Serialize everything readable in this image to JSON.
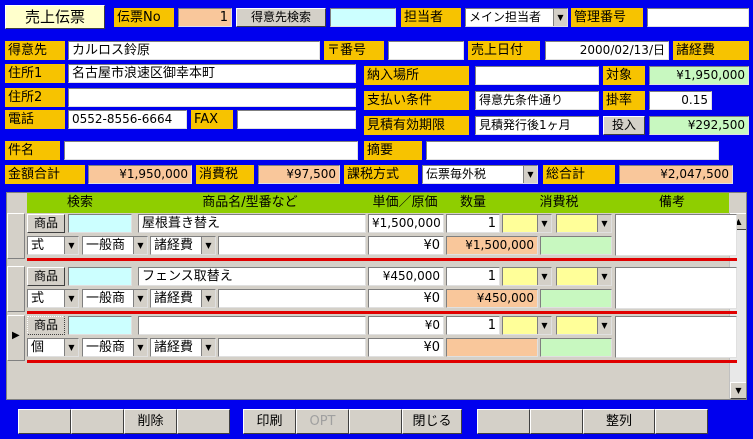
{
  "header": {
    "title": "売上伝票",
    "slip_no_label": "伝票No",
    "slip_no_value": "1",
    "customer_search_button": "得意先検索",
    "staff_label": "担当者",
    "staff_value": "メイン担当者",
    "mgmt_no_label": "管理番号",
    "mgmt_no_value": ""
  },
  "customer": {
    "name_label": "得意先",
    "name_value": "カルロス鈴原",
    "zip_label": "〒番号",
    "zip_value": "",
    "sale_date_label": "売上日付",
    "sale_date_value": "2000/02/13/日",
    "misc_label": "諸経費",
    "addr1_label": "住所1",
    "addr1_value": "名古屋市浪速区御幸本町",
    "delivery_label": "納入場所",
    "delivery_value": "",
    "target_label": "対象",
    "target_value": "¥1,950,000",
    "addr2_label": "住所2",
    "addr2_value": "",
    "payment_label": "支払い条件",
    "payment_value": "得意先条件通り",
    "rate_label": "掛率",
    "rate_value": "0.15",
    "tel_label": "電話",
    "tel_value": "0552-8556-6664",
    "fax_label": "FAX",
    "fax_value": "",
    "valid_label": "見積有効期限",
    "valid_value": "見積発行後1ヶ月",
    "input_button": "投入",
    "misc_value": "¥292,500",
    "subject_label": "件名",
    "subject_value": "",
    "summary_label": "摘要",
    "summary_value": ""
  },
  "totals": {
    "amount_label": "金額合計",
    "amount_value": "¥1,950,000",
    "tax_label": "消費税",
    "tax_value": "¥97,500",
    "taxmethod_label": "課税方式",
    "taxmethod_value": "伝票毎外税",
    "grand_label": "総合計",
    "grand_value": "¥2,047,500"
  },
  "grid": {
    "headers": [
      "検索",
      "商品名/型番など",
      "単価／原価",
      "数量",
      "消費税",
      "備考"
    ],
    "rows": [
      {
        "btn": "商品",
        "code": "",
        "name": "屋根葺き替え",
        "price": "¥1,500,000",
        "qty": "1",
        "unit": "式",
        "cat1": "一般商",
        "cat2": "諸経費",
        "spec": "",
        "cost": "¥0",
        "amount": "¥1,500,000"
      },
      {
        "btn": "商品",
        "code": "",
        "name": "フェンス取替え",
        "price": "¥450,000",
        "qty": "1",
        "unit": "式",
        "cat1": "一般商",
        "cat2": "諸経費",
        "spec": "",
        "cost": "¥0",
        "amount": "¥450,000"
      },
      {
        "btn": "商品",
        "code": "",
        "name": "",
        "price": "¥0",
        "qty": "1",
        "unit": "個",
        "cat1": "一般商",
        "cat2": "諸経費",
        "spec": "",
        "cost": "¥0",
        "amount": ""
      }
    ]
  },
  "footer": {
    "delete": "削除",
    "print": "印刷",
    "opt": "OPT",
    "close": "閉じる",
    "align": "整列"
  }
}
